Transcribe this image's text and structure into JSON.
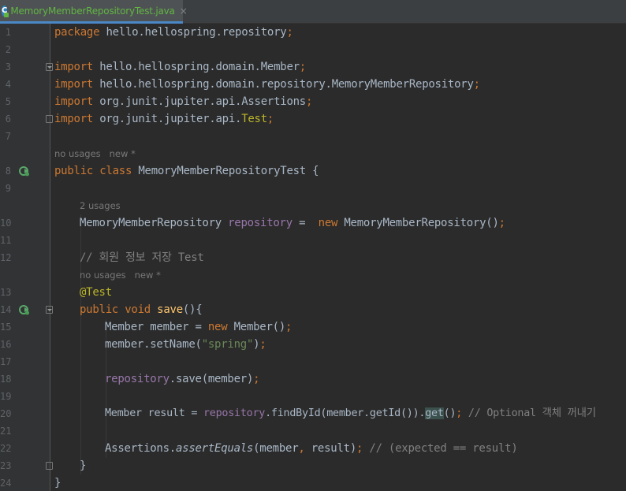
{
  "tab": {
    "title": "MemoryMemberRepositoryTest.java",
    "icon_letter": "C",
    "close_label": "×"
  },
  "lines": {
    "n1": "1",
    "n2": "2",
    "n3": "3",
    "n4": "4",
    "n5": "5",
    "n6": "6",
    "n7": "7",
    "n8": "8",
    "n9": "9",
    "n10": "10",
    "n11": "11",
    "n12": "12",
    "n13": "13",
    "n14": "14",
    "n15": "15",
    "n16": "16",
    "n17": "17",
    "n18": "18",
    "n19": "19",
    "n20": "20",
    "n21": "21",
    "n22": "22",
    "n23": "23",
    "n24": "24"
  },
  "code": {
    "l1_kw": "package",
    "l1_rest": " hello.hellospring.repository",
    "semi": ";",
    "import_kw": "import",
    "l3_rest": " hello.hellospring.domain.Member",
    "l4_rest": " hello.hellospring.domain.repository.MemoryMemberRepository",
    "l5_rest": " org.junit.jupiter.api.Assertions",
    "l6_rest": " org.junit.jupiter.api.",
    "l6_test": "Test",
    "hint_class": "no usages   new *",
    "l8_kw": "public class",
    "l8_rest": " MemoryMemberRepositoryTest {",
    "hint_field": "2 usages",
    "l10_type": "MemoryMemberRepository ",
    "l10_field": "repository",
    "l10_eq": " =  ",
    "l10_new": "new",
    "l10_rest": " MemoryMemberRepository()",
    "l12_comment": "// 회원 정보 저장 Test",
    "hint_method": "no usages   new *",
    "l13_ann": "@Test",
    "l14_kw": "public void",
    "l14_fn": "save",
    "l14_rest": "(){",
    "l15_a": "Member member = ",
    "l15_new": "new",
    "l15_b": " Member()",
    "l16_a": "member.setName(",
    "l16_str": "\"spring\"",
    "l16_b": ")",
    "l18_field": "repository",
    "l18_rest": ".save(member)",
    "l20_a": "Member result = ",
    "l20_field": "repository",
    "l20_b": ".findById(member.getId()).",
    "l20_get": "get",
    "l20_c": "()",
    "l20_cmt": "// Optional 객체 꺼내기",
    "l22_a": "Assertions.",
    "l22_fn": "assertEquals",
    "l22_b": "(member",
    "l22_comma": ",",
    "l22_c": " result)",
    "l22_cmt": "// (expected == result)",
    "l23": "}",
    "l24": "}"
  },
  "colors": {
    "keyword": "#cc7832",
    "field": "#9876aa",
    "string": "#6a8759",
    "comment": "#808080",
    "annotation": "#bbb529",
    "method": "#ffc66d",
    "text": "#a9b7c6"
  },
  "icons": {
    "run_gutter": "run-test-icon",
    "fold": "fold-marker-icon",
    "file": "java-class-icon"
  }
}
